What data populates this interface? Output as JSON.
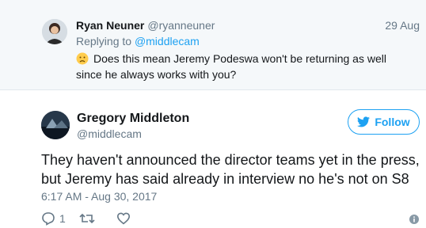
{
  "parent_tweet": {
    "name": "Ryan Neuner",
    "handle": "@ryanneuner",
    "date": "29 Aug",
    "replying_prefix": "Replying to",
    "replying_handle": "@middlecam",
    "text": "Does this mean Jeremy Podeswa won't be returning as well since he always works with you?"
  },
  "tweet": {
    "name": "Gregory Middleton",
    "handle": "@middlecam",
    "follow_label": "Follow",
    "text": "They haven't announced the director teams yet in the press, but Jeremy has said already in interview no he's not on S8",
    "timestamp": "6:17 AM - Aug 30, 2017",
    "reply_count": "1"
  },
  "colors": {
    "accent": "#1da1f2",
    "muted": "#657786",
    "text": "#14171a"
  },
  "icons": [
    "frowning-face-icon",
    "bird-icon",
    "reply-icon",
    "retweet-icon",
    "like-icon",
    "more-icon"
  ]
}
